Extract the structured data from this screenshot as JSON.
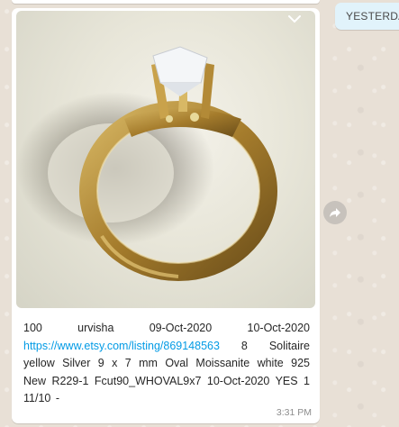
{
  "date_label": "YESTERDAY",
  "message": {
    "caption_line1": "100  urvisha  09-Oct-2020  10-Oct-2020",
    "link": "https://www.etsy.com/listing/869148563",
    "caption_rest": "8 Solitaire yellow Silver 9 x 7 mm Oval Moissanite white 925 New R229-1 Fcut90_WHOVAL9x7 10-Oct-2020 YES 1 11/10 -",
    "time": "3:31 PM"
  },
  "icons": {
    "menu": "chevron-down-icon",
    "forward": "forward-icon"
  },
  "colors": {
    "link": "#039be5",
    "date_pill": "#e1f3fb",
    "ring_gold": "#b9923e"
  }
}
